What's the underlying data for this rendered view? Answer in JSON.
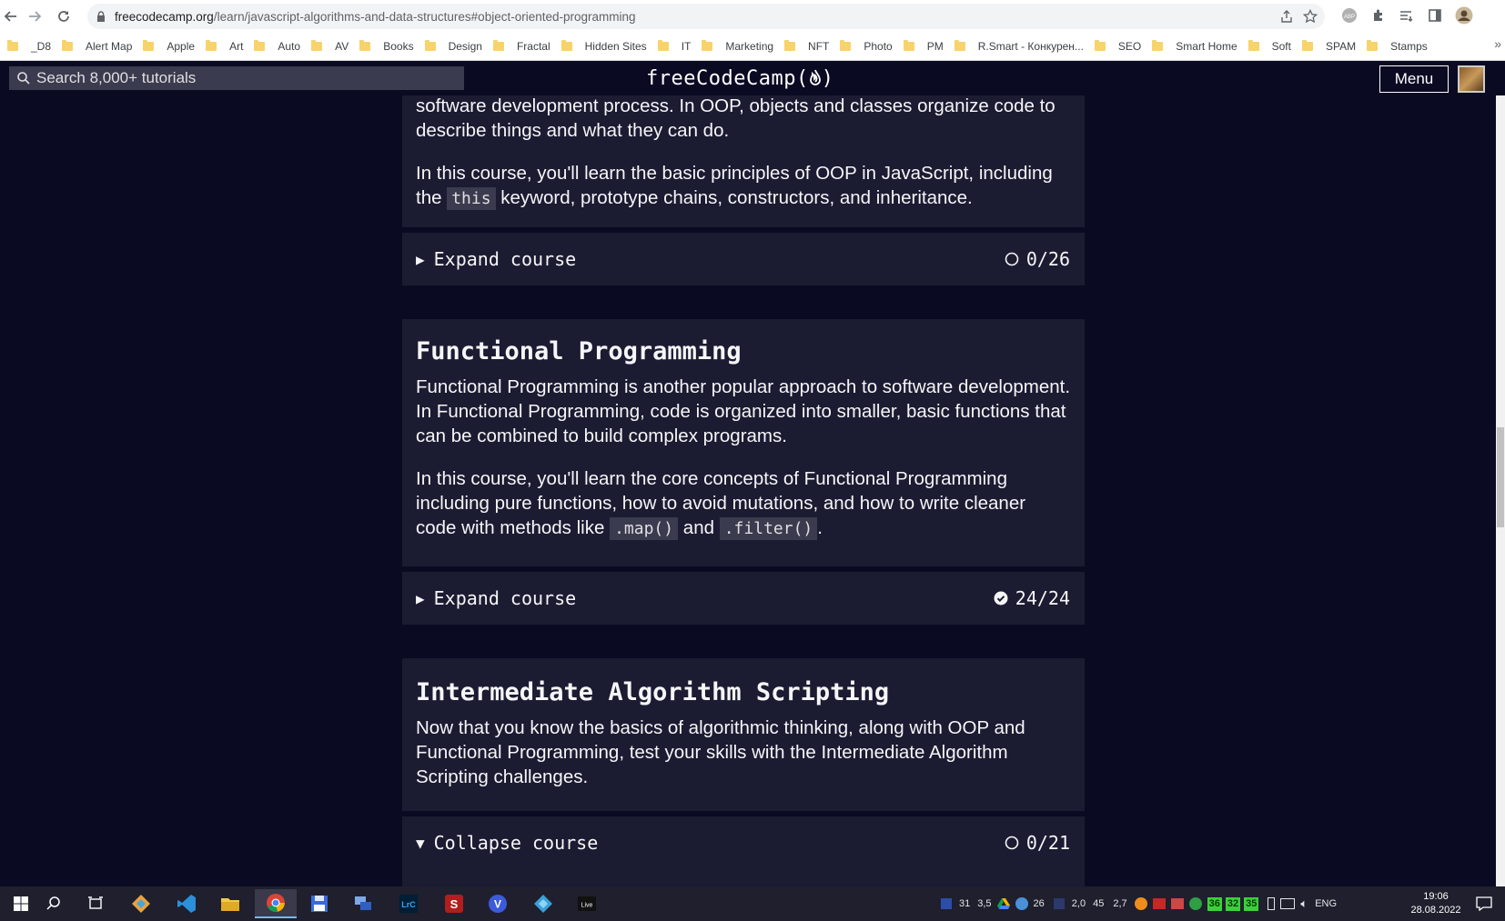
{
  "browser": {
    "url_domain": "freecodecamp.org",
    "url_path": "/learn/javascript-algorithms-and-data-structures#object-oriented-programming",
    "bookmarks": [
      "_D8",
      "Alert Map",
      "Apple",
      "Art",
      "Auto",
      "AV",
      "Books",
      "Design",
      "Fractal",
      "Hidden Sites",
      "IT",
      "Marketing",
      "NFT",
      "Photo",
      "PM",
      "R.Smart - Конкурен...",
      "SEO",
      "Smart Home",
      "Soft",
      "SPAM",
      "Stamps"
    ],
    "bookmarks_more": "»"
  },
  "fcc_nav": {
    "search_placeholder": "Search 8,000+ tutorials",
    "logo_text": "freeCodeCamp(",
    "logo_close": ")",
    "menu_label": "Menu"
  },
  "courses": [
    {
      "id": "oop",
      "paragraph1": "software development process. In OOP, objects and classes organize code to describe things and what they can do.",
      "paragraph2_pre": "In this course, you'll learn the basic principles of OOP in JavaScript, including the ",
      "paragraph2_code": "this",
      "paragraph2_post": " keyword, prototype chains, constructors, and inheritance.",
      "expand_label": "Expand course",
      "progress": "0/26",
      "complete": false
    },
    {
      "id": "functional-programming",
      "title": "Functional Programming",
      "paragraph1": "Functional Programming is another popular approach to software development. In Functional Programming, code is organized into smaller, basic functions that can be combined to build complex programs.",
      "paragraph2_pre": "In this course, you'll learn the core concepts of Functional Programming including pure functions, how to avoid mutations, and how to write cleaner code with methods like ",
      "paragraph2_code1": ".map()",
      "paragraph2_mid": " and ",
      "paragraph2_code2": ".filter()",
      "paragraph2_post": ".",
      "expand_label": "Expand course",
      "progress": "24/24",
      "complete": true
    },
    {
      "id": "intermediate-algorithm-scripting",
      "title": "Intermediate Algorithm Scripting",
      "paragraph1": "Now that you know the basics of algorithmic thinking, along with OOP and Functional Programming, test your skills with the Intermediate Algorithm Scripting challenges.",
      "expand_label": "Collapse course",
      "progress": "0/21",
      "complete": false
    }
  ],
  "taskbar": {
    "tray_values": [
      "31",
      "3,5",
      "26",
      "2,0",
      "45",
      "2,7"
    ],
    "tray_badges": [
      "36",
      "32",
      "35"
    ],
    "language": "ENG",
    "time": "19:06",
    "date": "28.08.2022"
  },
  "colors": {
    "page_bg": "#0a0a23",
    "card_bg": "#1b1b32",
    "code_bg": "#3b3b4f",
    "text": "#f5f6f7"
  }
}
